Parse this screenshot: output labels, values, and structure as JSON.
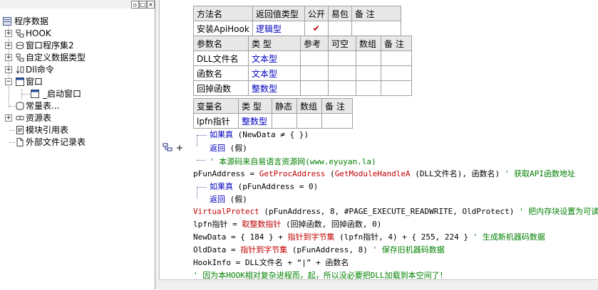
{
  "tree": {
    "root": "程序数据",
    "items": [
      {
        "label": "HOOK"
      },
      {
        "label": "窗口程序集2"
      },
      {
        "label": "自定义数据类型"
      },
      {
        "label": "Dll命令"
      },
      {
        "label": "窗口"
      },
      {
        "label": "_启动窗口"
      },
      {
        "label": "常量表..."
      },
      {
        "label": "资源表"
      },
      {
        "label": "模块引用表"
      },
      {
        "label": "外部文件记录表"
      }
    ]
  },
  "method_table": {
    "headers": [
      "方法名",
      "返回值类型",
      "公开",
      "易包",
      "备 注"
    ],
    "row": {
      "name": "安装ApiHook",
      "ret": "逻辑型",
      "public": "✔"
    }
  },
  "param_table": {
    "headers": [
      "参数名",
      "类 型",
      "参考",
      "可空",
      "数组",
      "备 注"
    ],
    "rows": [
      {
        "name": "DLL文件名",
        "type": "文本型"
      },
      {
        "name": "函数名",
        "type": "文本型"
      },
      {
        "name": "回掉函数",
        "type": "整数型"
      }
    ]
  },
  "var_table": {
    "headers": [
      "变量名",
      "类 型",
      "静态",
      "数组",
      "备 注"
    ],
    "row": {
      "name": "lpfn指针",
      "type": "整数型"
    }
  },
  "code": {
    "l1_kw": "如果真",
    "l1_rest": " (NewData ≠ {  })",
    "l2_kw": "返回",
    "l2_rest": " (假)",
    "l3": "' 本源码来自易语言资源网(www.eyuyan.la)",
    "l4_a": "pFunAddress = ",
    "l4_fn": "GetProcAddress",
    "l4_b": " (",
    "l4_fn2": "GetModuleHandleA",
    "l4_c": " (DLL文件名), 函数名)",
    "l4_cm": " ' 获取API函数地址",
    "l5_kw": "如果真",
    "l5_rest": " (pFunAddress = 0)",
    "l6_kw": "返回",
    "l6_rest": " (假)",
    "l7_fn": "VirtualProtect",
    "l7_a": " (pFunAddress, 8, #PAGE_EXECUTE_READWRITE, OldProtect)",
    "l7_cm": " ' 把内存块设置为可读写",
    "l8_a": "lpfn指针 = ",
    "l8_fn": "取整数指针",
    "l8_b": " (回掉函数, 回掉函数, 0)",
    "l9_a": "NewData = { 184 } + ",
    "l9_fn": "指针到字节集",
    "l9_b": " (lpfn指针, 4) + { 255, 224 }",
    "l9_cm": " ' 生成新机器码数据",
    "l10_a": "OldData = ",
    "l10_fn": "指针到字节集",
    "l10_b": " (pFunAddress, 8)",
    "l10_cm": " ' 保存旧机器码数据",
    "l11": "HookInfo = DLL文件名 + “|” + 函数名",
    "l12": "' 因为本HOOK相对复杂进程而，起，所以没必要把DLL加载到本空间了！"
  },
  "colors": {
    "keyword": "#0000c0",
    "function": "#c00000",
    "comment": "#008000"
  }
}
